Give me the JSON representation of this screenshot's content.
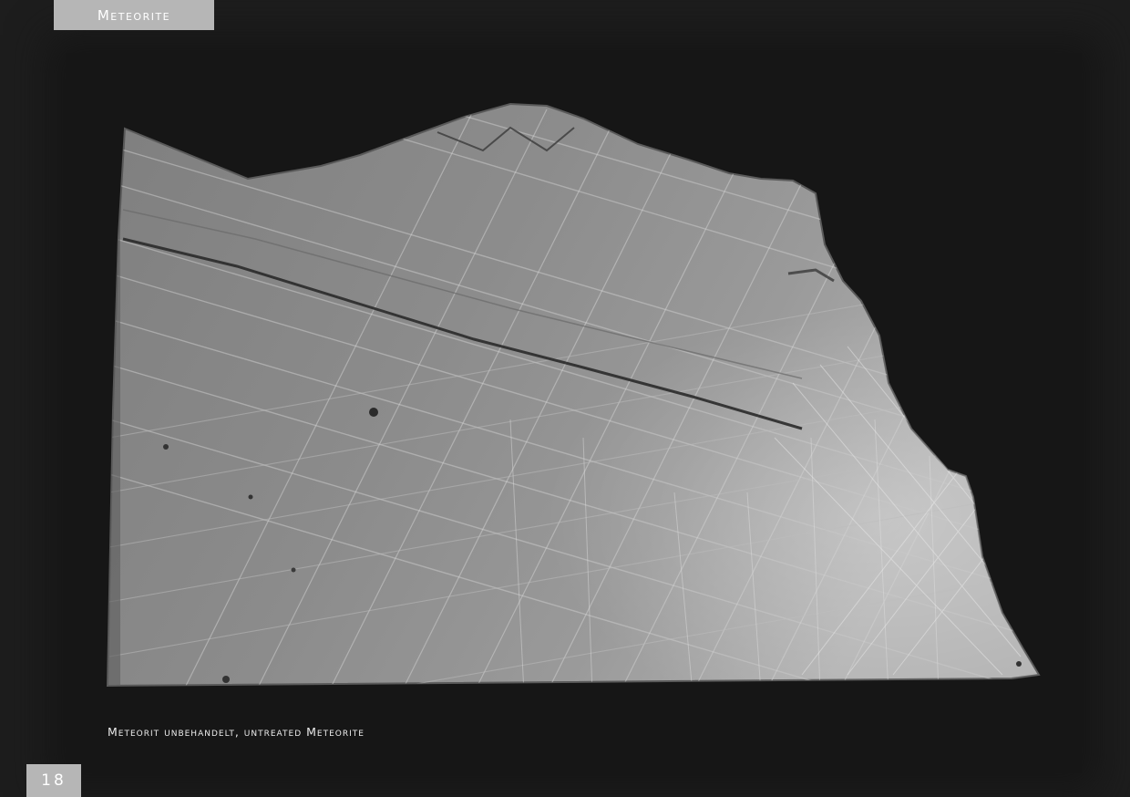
{
  "header": {
    "section_title": "Meteorite"
  },
  "figure": {
    "caption": "Meteorit unbehandelt, untreated Meteorite",
    "subject": "meteorite-slab"
  },
  "footer": {
    "page_number": "18"
  },
  "colors": {
    "page_background": "#1d1d1d",
    "tab_background": "#b6b6b6",
    "tab_text": "#ffffff",
    "caption_text": "#ececec",
    "meteorite_surface": "#8f8f8f"
  }
}
